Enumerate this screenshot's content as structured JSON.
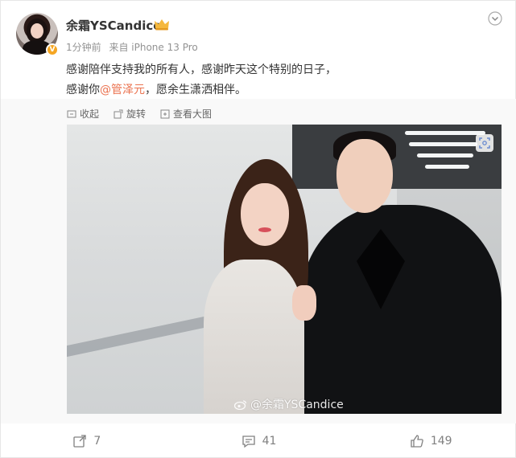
{
  "post": {
    "username": "余霜YSCandice",
    "time": "1分钟前",
    "source": "来自 iPhone 13 Pro",
    "text_line1": "感谢陪伴支持我的所有人，感谢昨天这个特别的日子，",
    "text_line2_prefix": "感谢你",
    "mention": "@管泽元",
    "text_line2_suffix": "，愿余生潇洒相伴。",
    "verified_badge": "V"
  },
  "tools": {
    "collapse": "收起",
    "rotate": "旋转",
    "view_large": "查看大图"
  },
  "photo": {
    "watermark": "@余霜YSCandice"
  },
  "actions": {
    "repost_count": "7",
    "comment_count": "41",
    "like_count": "149"
  },
  "colors": {
    "mention": "#eb7350",
    "badge": "#f5a623",
    "meta": "#939393"
  }
}
